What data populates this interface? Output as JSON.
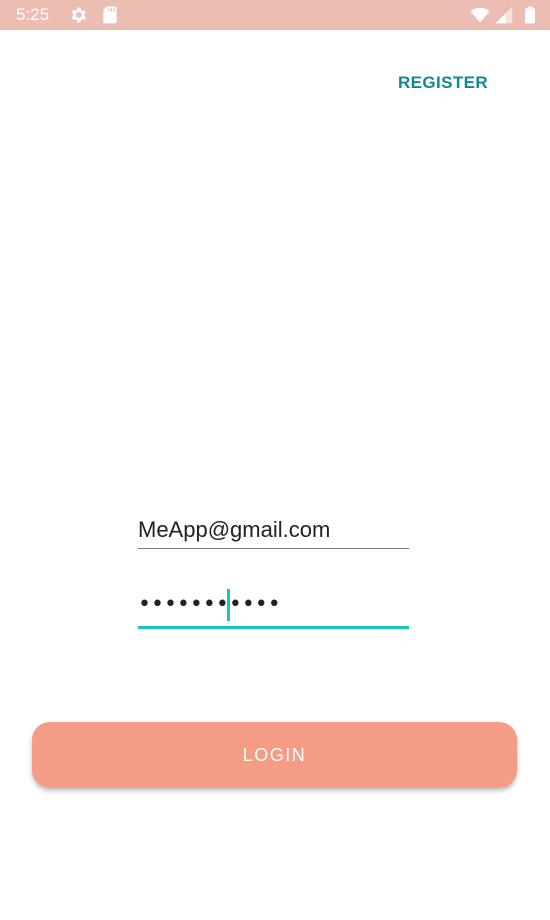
{
  "status_bar": {
    "time": "5:25",
    "icons": [
      "gear-icon",
      "sd-card-icon",
      "wifi-icon",
      "signal-icon",
      "battery-icon"
    ],
    "background_color": "#ecbdb2"
  },
  "header": {
    "register_label": "REGISTER"
  },
  "form": {
    "email_value": "MeApp@gmail.com",
    "password_masked": "•••••••••••"
  },
  "actions": {
    "login_label": "LOGIN"
  },
  "colors": {
    "accent": "#17c7bd",
    "link": "#128894",
    "button": "#f59c87"
  }
}
